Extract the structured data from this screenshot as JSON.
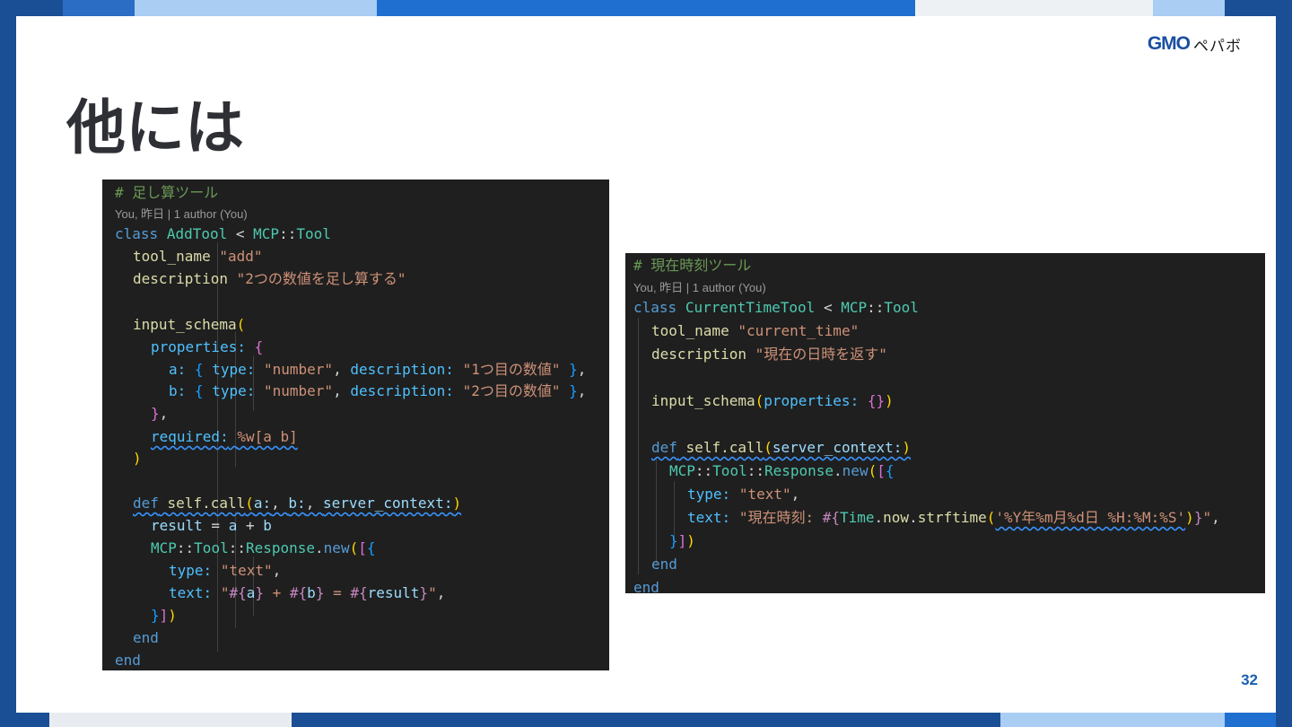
{
  "slide": {
    "title": "他には",
    "page_number": "32",
    "logo": {
      "brand": "GMO",
      "sub": "ペパボ"
    }
  },
  "colors": {
    "frame": "#1e5fae",
    "brand": "#1a4fa3",
    "code_bg": "#1f1f1f"
  },
  "code_left": {
    "comment": "# 足し算ツール",
    "blame": "You, 昨日 | 1 author (You)",
    "lines": [
      "class AddTool < MCP::Tool",
      "tool_name \"add\"",
      "description \"2つの数値を足し算する\"",
      "input_schema(",
      "properties: {",
      "a: { type: \"number\", description: \"1つ目の数値\" },",
      "b: { type: \"number\", description: \"2つ目の数値\" },",
      "},",
      "required: %w[a b]",
      ")",
      "def self.call(a:, b:, server_context:)",
      "result = a + b",
      "MCP::Tool::Response.new([{",
      "type: \"text\",",
      "text: \"#{a} + #{b} = #{result}\",",
      "}])",
      "end",
      "end"
    ]
  },
  "code_right": {
    "comment": "# 現在時刻ツール",
    "blame": "You, 昨日 | 1 author (You)",
    "lines": [
      "class CurrentTimeTool < MCP::Tool",
      "tool_name \"current_time\"",
      "description \"現在の日時を返す\"",
      "input_schema(properties: {})",
      "def self.call(server_context:)",
      "MCP::Tool::Response.new([{",
      "type: \"text\",",
      "text: \"現在時刻: #{Time.now.strftime('%Y年%m月%d日 %H:%M:%S')}\",",
      "}])",
      "end",
      "end"
    ]
  }
}
